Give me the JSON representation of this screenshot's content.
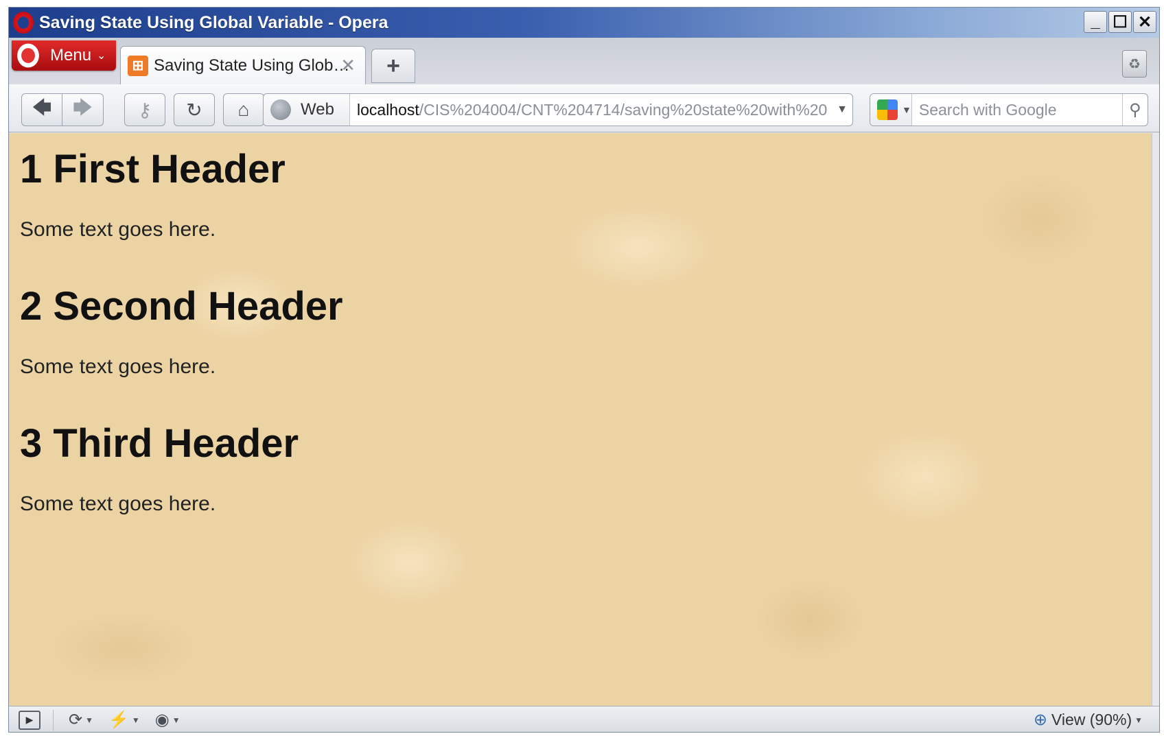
{
  "window": {
    "title": "Saving State Using Global Variable - Opera",
    "controls": {
      "minimize": "_",
      "maximize": "☐",
      "close": "✕"
    }
  },
  "tabbar": {
    "menu_label": "Menu",
    "active_tab": {
      "title": "Saving State Using Glob…",
      "close": "✕"
    },
    "new_tab": "+"
  },
  "navbar": {
    "back": "back-arrow-icon",
    "forward": "forward-arrow-icon",
    "key": "key-icon",
    "reload": "reload-icon",
    "home": "home-icon",
    "address": {
      "scheme_label": "Web",
      "url_host": "localhost",
      "url_path": "/CIS%204004/CNT%204714/saving%20state%20with%20"
    },
    "search": {
      "placeholder": "Search with Google"
    }
  },
  "content": {
    "sections": [
      {
        "header": "1 First Header",
        "text": "Some text goes here."
      },
      {
        "header": "2 Second Header",
        "text": "Some text goes here."
      },
      {
        "header": "3 Third Header",
        "text": "Some text goes here."
      }
    ]
  },
  "statusbar": {
    "zoom_label": "View (90%)"
  },
  "colors": {
    "title_bar": "#1d3e8c",
    "menu_button": "#c4161c",
    "page_background": "#ecd3a4"
  }
}
